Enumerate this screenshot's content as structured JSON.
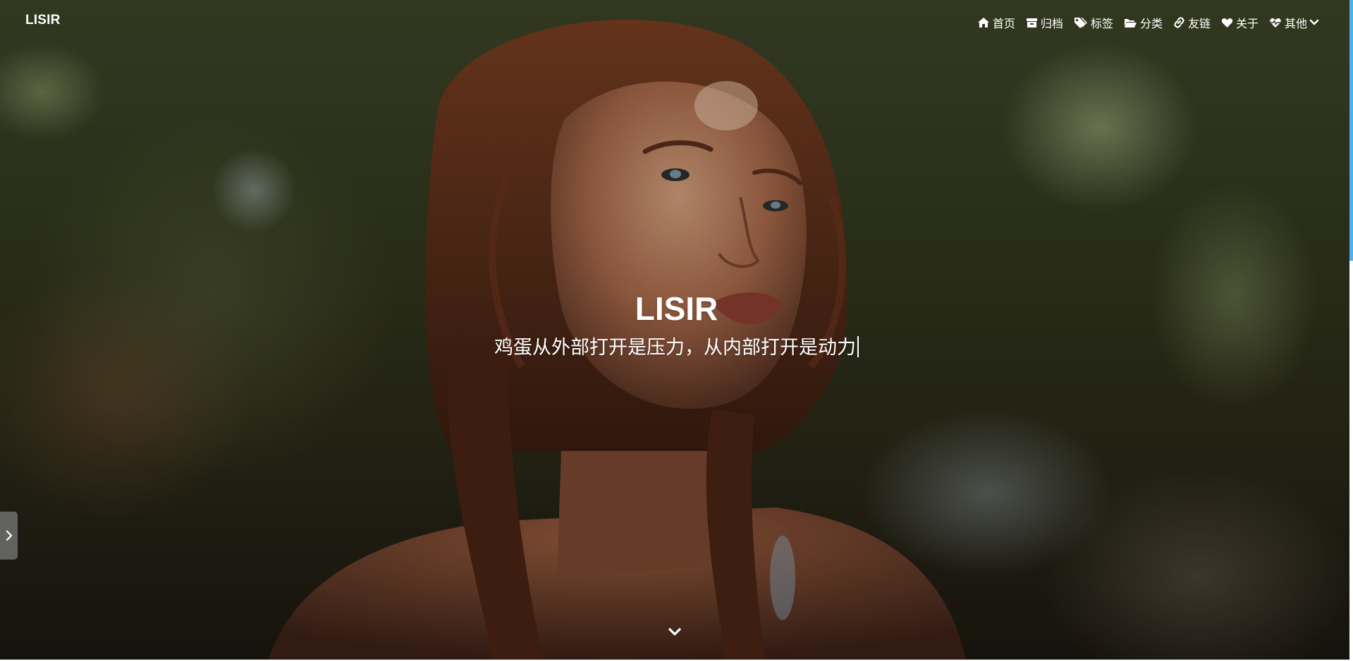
{
  "header": {
    "brand": "LISIR",
    "menu": [
      {
        "icon": "home-icon",
        "label": "首页"
      },
      {
        "icon": "archive-icon",
        "label": "归档"
      },
      {
        "icon": "tags-icon",
        "label": "标签"
      },
      {
        "icon": "folder-open-icon",
        "label": "分类"
      },
      {
        "icon": "link-icon",
        "label": "友链"
      },
      {
        "icon": "heart-icon",
        "label": "关于"
      },
      {
        "icon": "heartbeat-icon",
        "label": "其他",
        "dropdown": true
      }
    ]
  },
  "hero": {
    "title": "LISIR",
    "subtitle": "鸡蛋从外部打开是压力，从内部打开是动力"
  },
  "colors": {
    "accent": "#49b1f5",
    "text": "#ffffff",
    "side_toggle": "#6e6e6e"
  }
}
